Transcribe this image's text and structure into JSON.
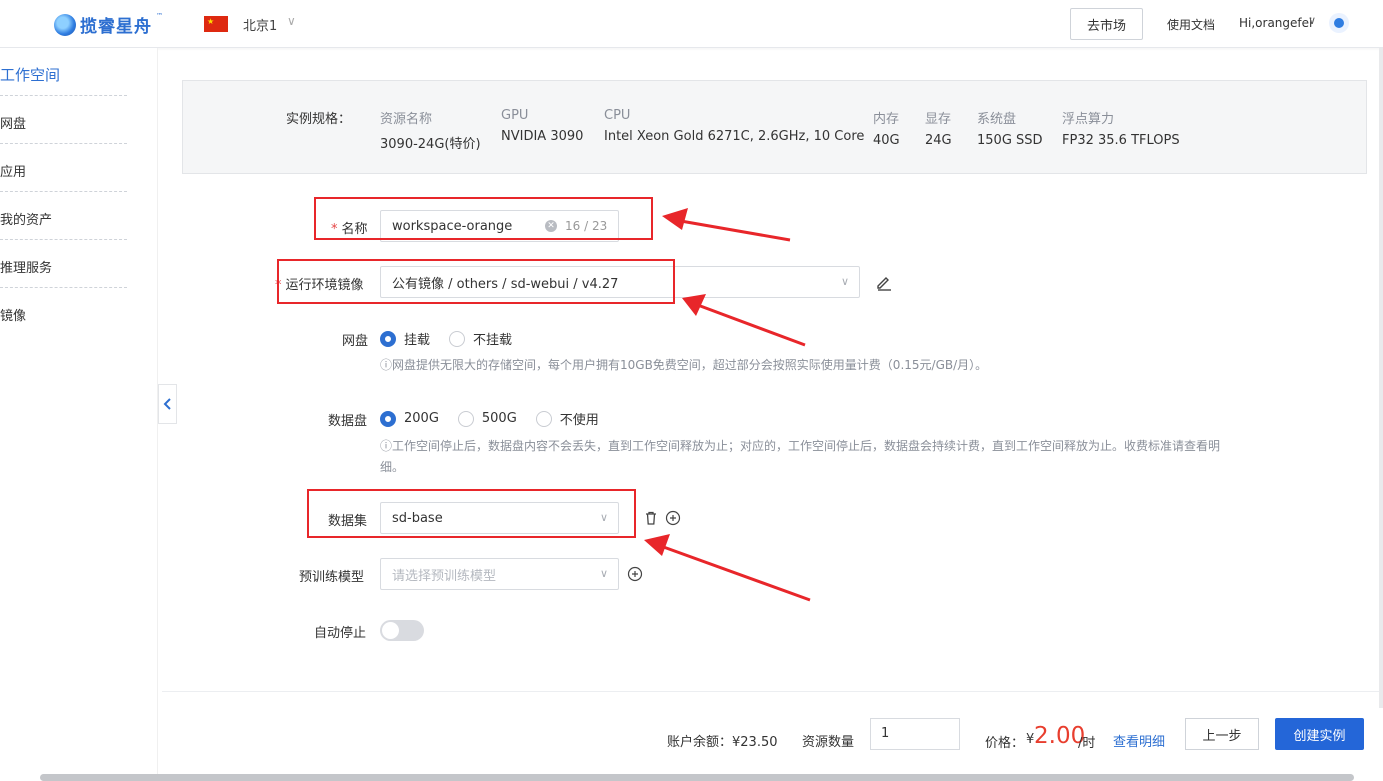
{
  "header": {
    "logo_text": "揽睿星舟",
    "logo_tm": "™",
    "region": "北京1",
    "market_button": "去市场",
    "docs_link": "使用文档",
    "user_greeting": "Hi,orangefei"
  },
  "sidebar": {
    "items": [
      {
        "label": "工作空间",
        "active": true
      },
      {
        "label": "网盘"
      },
      {
        "label": "应用"
      },
      {
        "label": "我的资产"
      },
      {
        "label": "推理服务"
      },
      {
        "label": "镜像"
      }
    ]
  },
  "spec": {
    "label": "实例规格：",
    "columns": [
      {
        "header": "资源名称",
        "value": "3090-24G(特价)"
      },
      {
        "header": "GPU",
        "value": "NVIDIA 3090"
      },
      {
        "header": "CPU",
        "value": "Intel Xeon Gold 6271C, 2.6GHz, 10 Core"
      },
      {
        "header": "内存",
        "value": "40G"
      },
      {
        "header": "显存",
        "value": "24G"
      },
      {
        "header": "系统盘",
        "value": "150G SSD"
      },
      {
        "header": "浮点算力",
        "value": "FP32 35.6 TFLOPS"
      }
    ]
  },
  "form": {
    "name": {
      "required_mark": "*",
      "label": "名称",
      "value": "workspace-orange",
      "counter": "16 / 23"
    },
    "image": {
      "required_mark": "*",
      "label": "运行环境镜像",
      "value": "公有镜像 / others / sd-webui / v4.27"
    },
    "netdisk": {
      "label": "网盘",
      "options": [
        "挂载",
        "不挂载"
      ],
      "selected": "挂载",
      "hint": "ⓘ网盘提供无限大的存储空间，每个用户拥有10GB免费空间，超过部分会按照实际使用量计费（0.15元/GB/月）。"
    },
    "datadisk": {
      "label": "数据盘",
      "options": [
        "200G",
        "500G",
        "不使用"
      ],
      "selected": "200G",
      "hint_line1": "ⓘ工作空间停止后，数据盘内容不会丢失，直到工作空间释放为止；对应的，工作空间停止后，数据盘会持续计费，直到工作空间释放为止。收费标准请查看明",
      "hint_line2": "细。"
    },
    "dataset": {
      "label": "数据集",
      "value": "sd-base"
    },
    "pretrained": {
      "label": "预训练模型",
      "placeholder": "请选择预训练模型"
    },
    "autostop": {
      "label": "自动停止",
      "enabled": false
    }
  },
  "footer": {
    "balance": "账户余额：¥23.50",
    "quantity_label": "资源数量",
    "quantity_value": "1",
    "price_label": "价格：",
    "price_currency": "¥",
    "price_value": "2.00",
    "price_unit": "/时",
    "detail_link": "查看明细",
    "prev_button": "上一步",
    "create_button": "创建实例"
  },
  "colors": {
    "accent": "#2466d8",
    "annotation": "#e8262a",
    "price": "#e83e2e"
  }
}
